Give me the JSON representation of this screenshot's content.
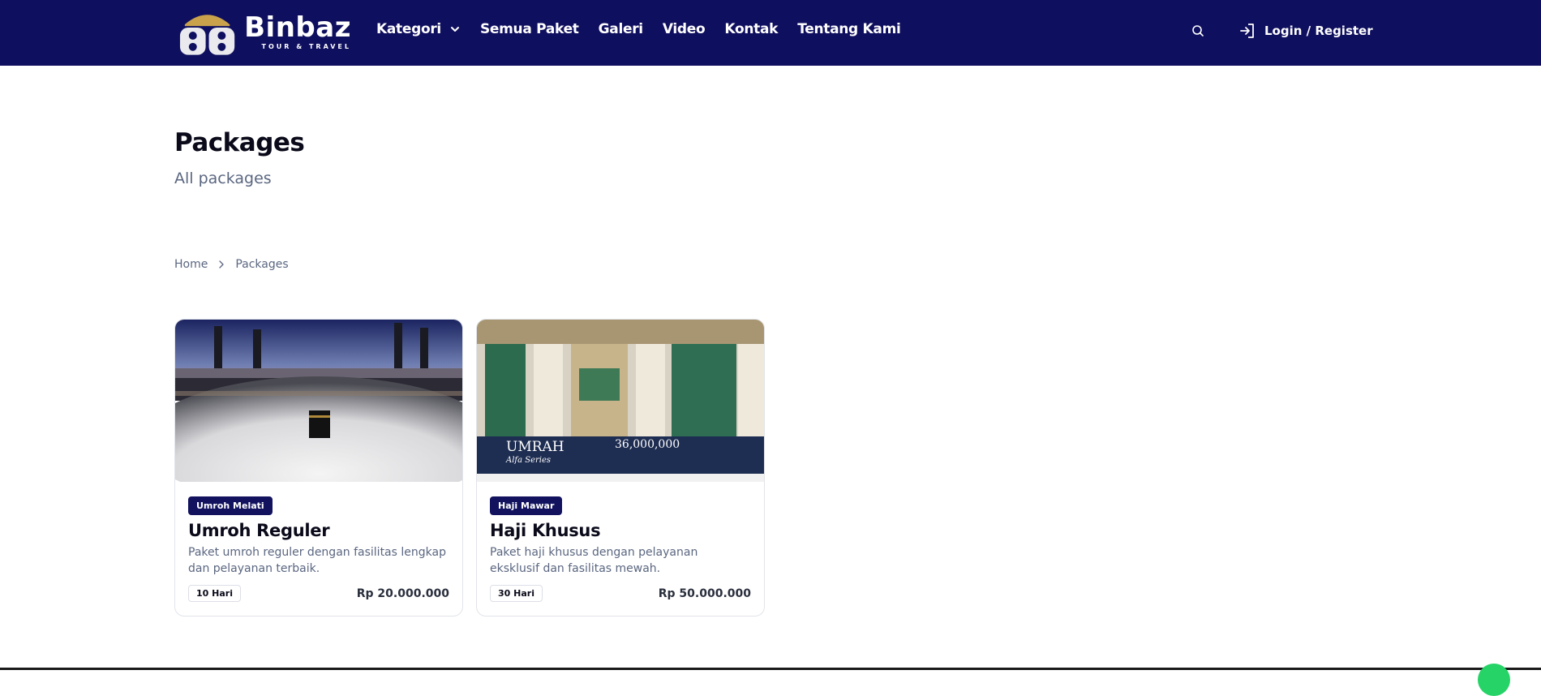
{
  "brand": {
    "name": "Binbaz",
    "tagline": "TOUR & TRAVEL",
    "color_primary": "#0f0f5f"
  },
  "nav": {
    "items": [
      {
        "label": "Kategori",
        "has_dropdown": true
      },
      {
        "label": "Semua Paket"
      },
      {
        "label": "Galeri"
      },
      {
        "label": "Video"
      },
      {
        "label": "Kontak"
      },
      {
        "label": "Tentang Kami"
      }
    ],
    "search_icon": "search-icon",
    "login_label": "Login / Register"
  },
  "page": {
    "title": "Packages",
    "subtitle": "All packages"
  },
  "breadcrumb": {
    "home": "Home",
    "current": "Packages"
  },
  "packages": [
    {
      "badge": "Umroh Melati",
      "title": "Umroh Reguler",
      "description": "Paket umroh reguler dengan fasilitas lengkap dan pelayanan terbaik.",
      "duration": "10 Hari",
      "price": "Rp 20.000.000"
    },
    {
      "badge": "Haji Mawar",
      "title": "Haji Khusus",
      "description": "Paket haji khusus dengan pelayanan eksklusif dan fasilitas mewah.",
      "duration": "30 Hari",
      "price": "Rp 50.000.000",
      "banner": {
        "title": "UMRAH",
        "series": "Alfa Series",
        "price": "36,000,000"
      }
    }
  ]
}
